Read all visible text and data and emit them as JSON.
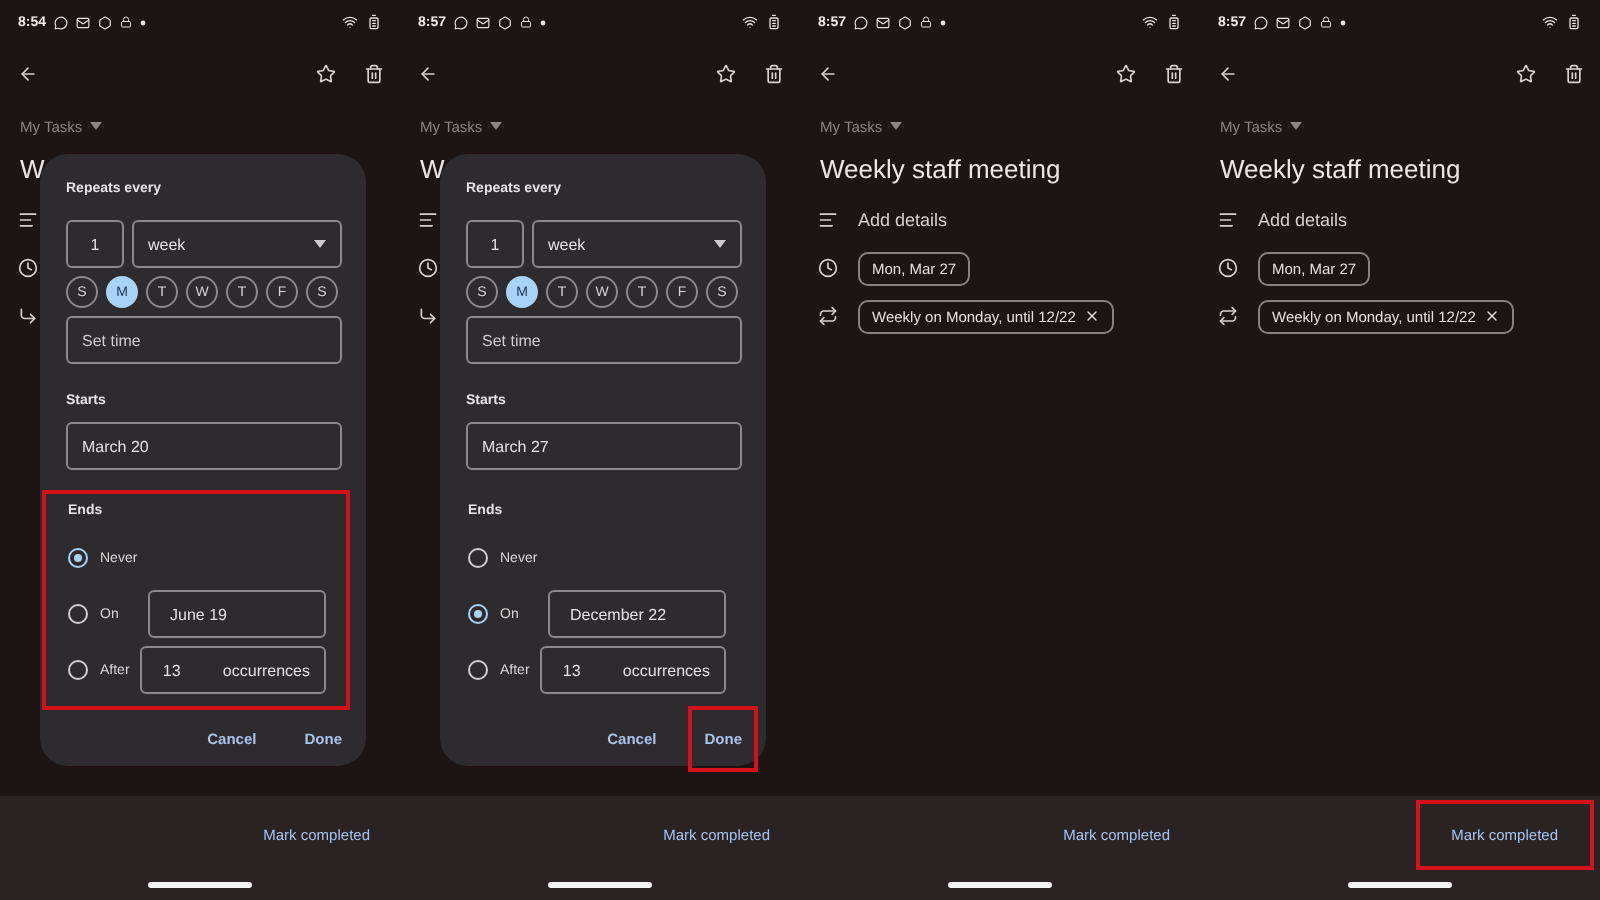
{
  "panels": [
    {
      "status_time": "8:54",
      "list_label": "My Tasks",
      "title": "W",
      "dialog": {
        "repeats_label": "Repeats every",
        "count": "1",
        "unit": "week",
        "days": [
          {
            "label": "S",
            "selected": false
          },
          {
            "label": "M",
            "selected": true
          },
          {
            "label": "T",
            "selected": false
          },
          {
            "label": "W",
            "selected": false
          },
          {
            "label": "T",
            "selected": false
          },
          {
            "label": "F",
            "selected": false
          },
          {
            "label": "S",
            "selected": false
          }
        ],
        "time_placeholder": "Set time",
        "starts_label": "Starts",
        "start": "March 20",
        "ends": {
          "label": "Ends",
          "highlighted": true,
          "options": [
            {
              "label": "Never",
              "selected": true
            },
            {
              "label": "On",
              "selected": false,
              "value": "June 19"
            },
            {
              "label": "After",
              "selected": false,
              "value": "13",
              "suffix": "occurrences"
            }
          ]
        },
        "buttons": [
          {
            "label": "Cancel",
            "highlighted": false
          },
          {
            "label": "Done",
            "highlighted": false
          }
        ]
      },
      "footer": {
        "label": "Mark completed",
        "highlighted": false
      }
    },
    {
      "status_time": "8:57",
      "list_label": "My Tasks",
      "title": "W",
      "dialog": {
        "repeats_label": "Repeats every",
        "count": "1",
        "unit": "week",
        "days": [
          {
            "label": "S",
            "selected": false
          },
          {
            "label": "M",
            "selected": true
          },
          {
            "label": "T",
            "selected": false
          },
          {
            "label": "W",
            "selected": false
          },
          {
            "label": "T",
            "selected": false
          },
          {
            "label": "F",
            "selected": false
          },
          {
            "label": "S",
            "selected": false
          }
        ],
        "time_placeholder": "Set time",
        "starts_label": "Starts",
        "start": "March 27",
        "ends": {
          "label": "Ends",
          "highlighted": false,
          "options": [
            {
              "label": "Never",
              "selected": false
            },
            {
              "label": "On",
              "selected": true,
              "value": "December 22"
            },
            {
              "label": "After",
              "selected": false,
              "value": "13",
              "suffix": "occurrences"
            }
          ]
        },
        "buttons": [
          {
            "label": "Cancel",
            "highlighted": false
          },
          {
            "label": "Done",
            "highlighted": true
          }
        ]
      },
      "footer": {
        "label": "Mark completed",
        "highlighted": false
      }
    },
    {
      "status_time": "8:57",
      "list_label": "My Tasks",
      "title": "Weekly staff meeting",
      "details": {
        "add_details": "Add details",
        "date": "Mon, Mar 27",
        "repeat": "Weekly on Monday, until 12/22"
      },
      "footer": {
        "label": "Mark completed",
        "highlighted": false
      }
    },
    {
      "status_time": "8:57",
      "list_label": "My Tasks",
      "title": "Weekly staff meeting",
      "details": {
        "add_details": "Add details",
        "date": "Mon, Mar 27",
        "repeat": "Weekly on Monday, until 12/22"
      },
      "footer": {
        "label": "Mark completed",
        "highlighted": true
      }
    }
  ]
}
